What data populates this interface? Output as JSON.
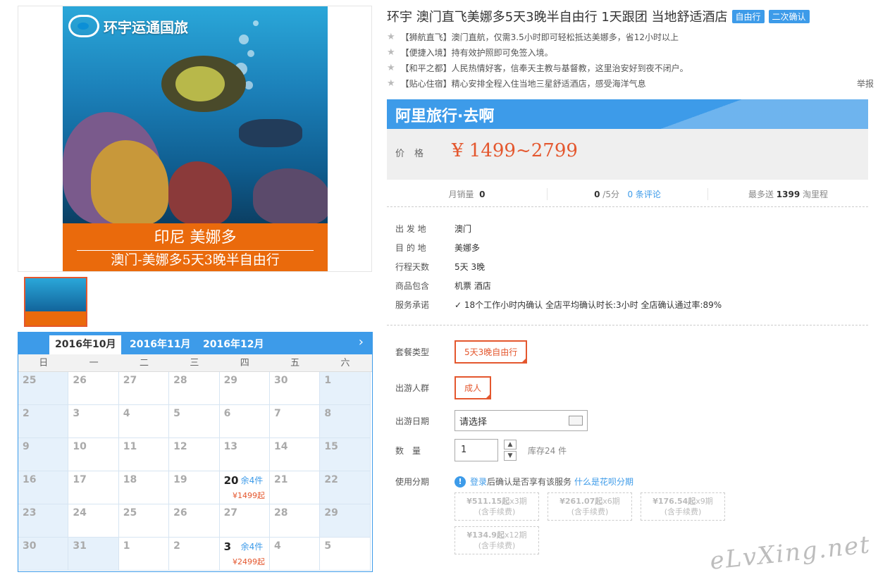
{
  "product": {
    "title": "环宇 澳门直飞美娜多5天3晚半自由行 1天跟团 当地舒适酒店",
    "tags": [
      "自由行",
      "二次确认"
    ],
    "highlights": [
      "【狮航直飞】澳门直航，仅需3.5小时即可轻松抵达美娜多，省12小时以上",
      "【便捷入境】持有效护照即可免签入境。",
      "【和平之都】人民热情好客，信奉天主教与基督教，这里治安好到夜不闭户。",
      "【贴心住宿】精心安排全程入住当地三星舒适酒店，感受海洋气息"
    ],
    "report": "举报"
  },
  "image": {
    "logo_text": "环宇运通国旅",
    "banner_line1": "印尼  美娜多",
    "banner_line2": "澳门-美娜多5天3晚半自由行"
  },
  "price_box": {
    "brand": "阿里旅行·去啊",
    "label": "价格",
    "value": "¥ 1499~2799"
  },
  "stats": {
    "monthly_sales_label": "月销量",
    "monthly_sales": "0",
    "rating": "0",
    "rating_suffix": "/5分",
    "reviews": "0 条评论",
    "mileage_prefix": "最多送",
    "mileage": "1399",
    "mileage_suffix": "淘里程"
  },
  "info": [
    {
      "k": "出 发 地",
      "v": "澳门"
    },
    {
      "k": "目 的 地",
      "v": "美娜多"
    },
    {
      "k": "行程天数",
      "v": "5天 3晚"
    },
    {
      "k": "商品包含",
      "v": "机票   酒店"
    },
    {
      "k": "服务承诺",
      "v": "18个工作小时内确认    全店平均确认时长:3小时    全店确认通过率:89%"
    }
  ],
  "options": {
    "package_label": "套餐类型",
    "package_value": "5天3晚自由行",
    "crowd_label": "出游人群",
    "crowd_value": "成人",
    "date_label": "出游日期",
    "date_placeholder": "请选择",
    "qty_label": "数　量",
    "qty_value": "1",
    "stock": "库存24 件",
    "installment_label": "使用分期",
    "login_link": "登录",
    "login_text": "后确认是否享有该服务",
    "huabei_link": "什么是花呗分期",
    "installments": [
      {
        "amount": "¥511.15起",
        "period": "x3期",
        "note": "(含手续费)"
      },
      {
        "amount": "¥261.07起",
        "period": "x6期",
        "note": "(含手续费)"
      },
      {
        "amount": "¥176.54起",
        "period": "x9期",
        "note": "(含手续费)"
      },
      {
        "amount": "¥134.9起",
        "period": "x12期",
        "note": "(含手续费)"
      }
    ]
  },
  "calendar": {
    "months": [
      "2016年10月",
      "2016年11月",
      "2016年12月"
    ],
    "next": "›",
    "weekdays": [
      "日",
      "一",
      "二",
      "三",
      "四",
      "五",
      "六"
    ],
    "weeks": [
      [
        {
          "d": "25"
        },
        {
          "d": "26"
        },
        {
          "d": "27"
        },
        {
          "d": "28"
        },
        {
          "d": "29"
        },
        {
          "d": "30"
        },
        {
          "d": "1"
        }
      ],
      [
        {
          "d": "2"
        },
        {
          "d": "3"
        },
        {
          "d": "4"
        },
        {
          "d": "5"
        },
        {
          "d": "6"
        },
        {
          "d": "7"
        },
        {
          "d": "8"
        }
      ],
      [
        {
          "d": "9"
        },
        {
          "d": "10"
        },
        {
          "d": "11"
        },
        {
          "d": "12"
        },
        {
          "d": "13"
        },
        {
          "d": "14"
        },
        {
          "d": "15"
        }
      ],
      [
        {
          "d": "16"
        },
        {
          "d": "17"
        },
        {
          "d": "18"
        },
        {
          "d": "19"
        },
        {
          "d": "20",
          "stock": "余4件",
          "price": "¥1499起"
        },
        {
          "d": "21"
        },
        {
          "d": "22"
        }
      ],
      [
        {
          "d": "23"
        },
        {
          "d": "24"
        },
        {
          "d": "25"
        },
        {
          "d": "26"
        },
        {
          "d": "27"
        },
        {
          "d": "28"
        },
        {
          "d": "29"
        }
      ],
      [
        {
          "d": "30"
        },
        {
          "d": "31"
        },
        {
          "d": "1"
        },
        {
          "d": "2"
        },
        {
          "d": "3",
          "stock": "余4件",
          "price": "¥2499起"
        },
        {
          "d": "4"
        },
        {
          "d": "5"
        }
      ]
    ]
  },
  "watermark": "eLvXing.net"
}
